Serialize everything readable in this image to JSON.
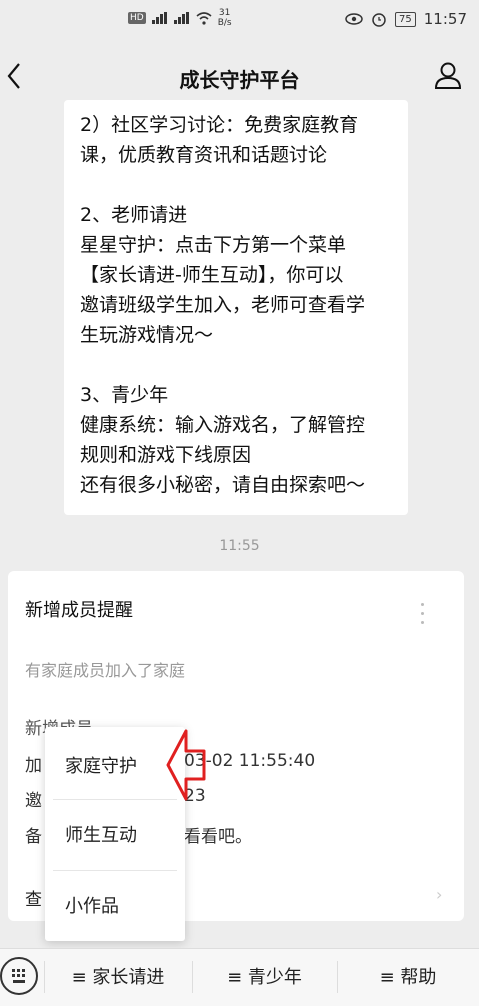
{
  "status": {
    "net_speed_value": "31",
    "net_speed_unit": "B/s",
    "battery": "75",
    "time": "11:57"
  },
  "header": {
    "title": "成长守护平台"
  },
  "message": {
    "lines": [
      "2）社区学习讨论：免费家庭教育",
      "课，优质教育资讯和话题讨论",
      "2、老师请进",
      "星星守护：点击下方第一个菜单",
      "【家长请进-师生互动】，你可以",
      "邀请班级学生加入，老师可查看学",
      "生玩游戏情况～",
      "3、青少年",
      "健康系统：输入游戏名，了解管控",
      "规则和游戏下线原因",
      "还有很多小秘密，请自由探索吧～"
    ]
  },
  "timestamp": "11:55",
  "card": {
    "title": "新增成员提醒",
    "subtitle": "有家庭成员加入了家庭",
    "rows": [
      "新增成员",
      "加",
      "邀",
      "备"
    ],
    "time_partial": "03-02 11:55:40",
    "invite_partial": "23",
    "note_partial": "看看吧。",
    "view_label": "查"
  },
  "popup": {
    "items": [
      "家庭守护",
      "师生互动",
      "小作品"
    ]
  },
  "bottom_menu": {
    "items": [
      "≡ 家长请进",
      "≡ 青少年",
      "≡ 帮助"
    ]
  }
}
